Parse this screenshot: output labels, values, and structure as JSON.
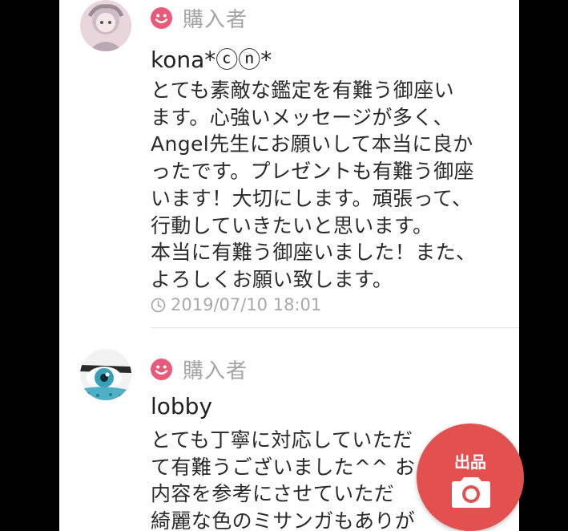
{
  "reviews": [
    {
      "role": "購入者",
      "username": "kona*ⓒⓝ*",
      "comment": "とても素敵な鑑定を有難う御座い\nます。心強いメッセージが多く、\nAngel先生にお願いして本当に良か\nったです。プレゼントも有難う御座\nいます！大切にします。頑張って、\n行動していきたいと思います。\n本当に有難う御座いました！また、\nよろしくお願い致します。",
      "datetime": "2019/07/10 18:01"
    },
    {
      "role": "購入者",
      "username": "lobby",
      "comment": "とても丁寧に対応していただ\nて有難うございました^^ お\n内容を参考にさせていただ\n綺麗な色のミサンガもありが"
    }
  ],
  "fab": {
    "label": "出品",
    "icon": "camera-icon"
  },
  "colors": {
    "accent": "#e35050",
    "buyer_icon": "#e95a7a"
  }
}
